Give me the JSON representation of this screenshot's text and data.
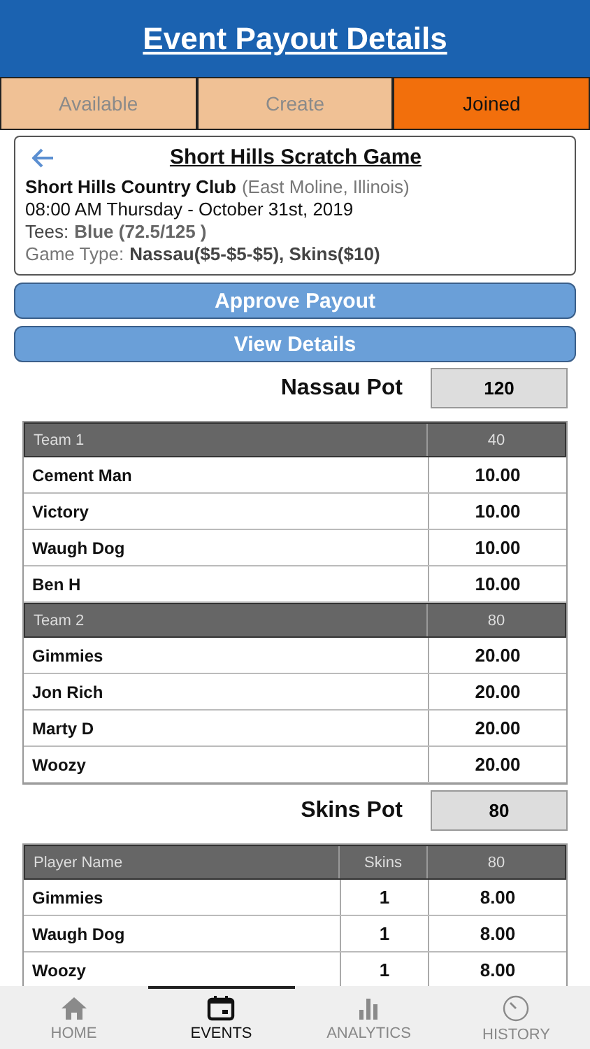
{
  "header": {
    "title": "Event Payout Details"
  },
  "tabs": [
    {
      "label": "Available",
      "selected": false
    },
    {
      "label": "Create",
      "selected": false
    },
    {
      "label": "Joined",
      "selected": true
    }
  ],
  "event": {
    "title": "Short Hills Scratch Game",
    "club": "Short Hills Country Club",
    "location": "(East Moline, Illinois)",
    "datetime": "08:00 AM Thursday - October 31st, 2019",
    "tees_label": "Tees:",
    "tees_value": "Blue (72.5/125 )",
    "game_type_label": "Game Type:",
    "game_type_value": "Nassau($5-$5-$5), Skins($10)"
  },
  "buttons": [
    "Approve Payout",
    "View Details"
  ],
  "nassau": {
    "label": "Nassau Pot",
    "value": "120",
    "teams": [
      {
        "name": "Team 1",
        "total": "40",
        "players": [
          {
            "name": "Cement Man",
            "amount": "10.00"
          },
          {
            "name": "Victory",
            "amount": "10.00"
          },
          {
            "name": "Waugh Dog",
            "amount": "10.00"
          },
          {
            "name": "Ben H",
            "amount": "10.00"
          }
        ]
      },
      {
        "name": "Team 2",
        "total": "80",
        "players": [
          {
            "name": "Gimmies",
            "amount": "20.00"
          },
          {
            "name": "Jon Rich",
            "amount": "20.00"
          },
          {
            "name": "Marty D",
            "amount": "20.00"
          },
          {
            "name": "Woozy",
            "amount": "20.00"
          }
        ]
      }
    ]
  },
  "skins": {
    "label": "Skins Pot",
    "value": "80",
    "columns": [
      "Player Name",
      "Skins",
      "80"
    ],
    "rows": [
      {
        "name": "Gimmies",
        "skins": "1",
        "amount": "8.00"
      },
      {
        "name": "Waugh Dog",
        "skins": "1",
        "amount": "8.00"
      },
      {
        "name": "Woozy",
        "skins": "1",
        "amount": "8.00"
      }
    ]
  },
  "bottom_nav": [
    {
      "label": "HOME",
      "kind": "home",
      "selected": false
    },
    {
      "label": "EVENTS",
      "kind": "calendar",
      "selected": true
    },
    {
      "label": "ANALYTICS",
      "kind": "chart",
      "selected": false
    },
    {
      "label": "HISTORY",
      "kind": "clock",
      "selected": false
    }
  ]
}
